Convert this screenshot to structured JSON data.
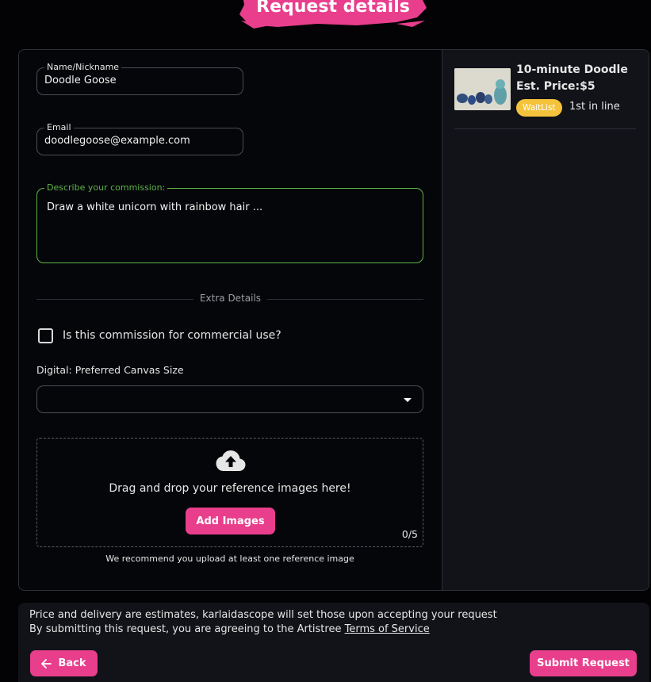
{
  "header": {
    "title": "Request details"
  },
  "form": {
    "name": {
      "label": "Name/Nickname",
      "value": "Doodle Goose"
    },
    "email": {
      "label": "Email",
      "value": "doodlegoose@example.com"
    },
    "description": {
      "label": "Describe your commission:",
      "value": "Draw a white unicorn with rainbow hair ..."
    },
    "extra_details_divider": "Extra Details",
    "commercial_checkbox": {
      "label": "Is this commission for commercial use?",
      "checked": false
    },
    "canvas_size": {
      "label": "Digital: Preferred Canvas Size",
      "selected": ""
    },
    "upload": {
      "icon": "cloud-upload-icon",
      "text": "Drag and drop your reference images here!",
      "button": "Add Images",
      "count": "0/5",
      "recommendation": "We recommend you upload at least one reference image"
    }
  },
  "sidebar": {
    "item": {
      "title": "10-minute Doodle",
      "price": "Est. Price:$5",
      "badge": "WaitList",
      "position": "1st in line"
    }
  },
  "footer": {
    "notice": "Price and delivery are estimates, karlaidascope will set those upon accepting your request",
    "agreement": "By submitting this request, you are agreeing to the Artistree",
    "tos_link": "Terms of Service",
    "back_button": "Back",
    "submit_button": "Submit Request"
  },
  "colors": {
    "accent": "#e83e8c",
    "focus": "#5fb34a",
    "waitlist": "#f5c33b",
    "background": "#030305",
    "panel": "#111318"
  }
}
